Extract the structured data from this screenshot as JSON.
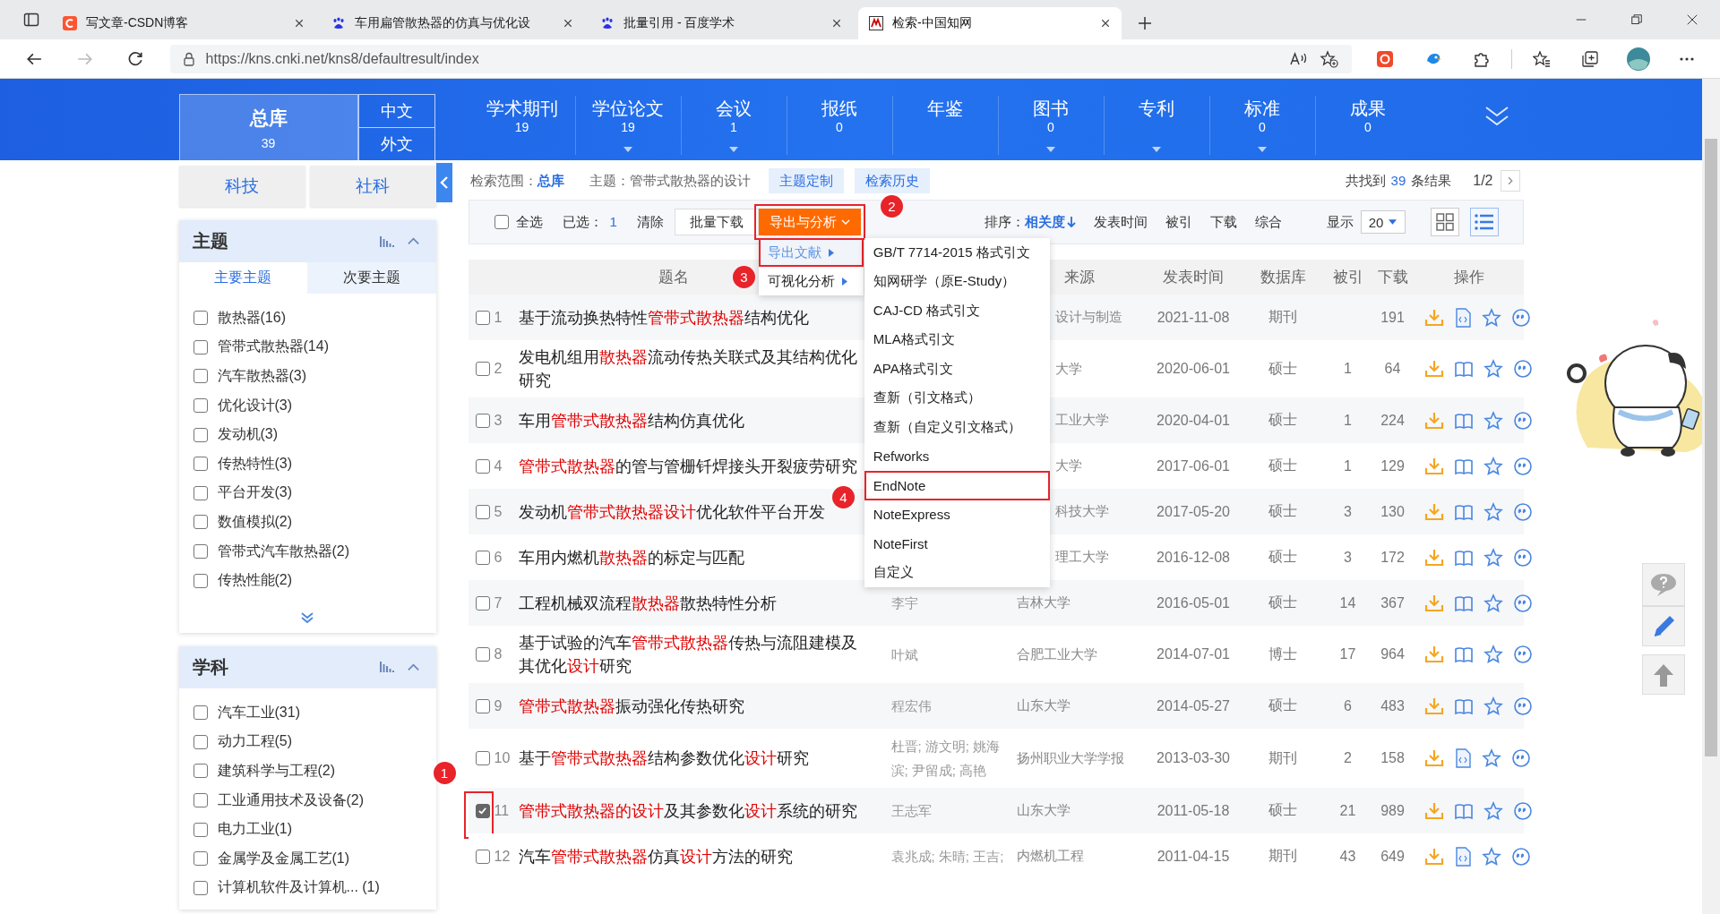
{
  "browser": {
    "tabs": [
      {
        "title": "写文章-CSDN博客",
        "kind": "csdn",
        "selected": false
      },
      {
        "title": "车用扁管散热器的仿真与优化设",
        "kind": "baidu",
        "selected": false
      },
      {
        "title": "批量引用 - 百度学术",
        "kind": "baidu",
        "selected": false
      },
      {
        "title": "检索-中国知网",
        "kind": "cnki",
        "selected": true
      }
    ],
    "url": "https://kns.cnki.net/kns8/defaultresult/index"
  },
  "nav": {
    "main": {
      "label": "总库",
      "count": "39"
    },
    "languages": [
      "中文",
      "外文"
    ],
    "items": [
      {
        "label": "学术期刊",
        "count": "19",
        "dropdown": false
      },
      {
        "label": "学位论文",
        "count": "19",
        "dropdown": true
      },
      {
        "label": "会议",
        "count": "1",
        "dropdown": true
      },
      {
        "label": "报纸",
        "count": "0",
        "dropdown": false
      },
      {
        "label": "年鉴",
        "dropdown": false
      },
      {
        "label": "图书",
        "count": "0",
        "dropdown": true
      },
      {
        "label": "专利",
        "dropdown": true
      },
      {
        "label": "标准",
        "count": "0",
        "dropdown": true
      },
      {
        "label": "成果",
        "count": "0",
        "dropdown": false
      }
    ]
  },
  "sidebar": {
    "tabs": [
      "科技",
      "社科"
    ],
    "panels": [
      {
        "title": "主题",
        "subtabs": [
          {
            "label": "主要主题",
            "selected": true
          },
          {
            "label": "次要主题",
            "selected": false
          }
        ],
        "more": true,
        "items": [
          {
            "label": "散热器(16)",
            "checked": false
          },
          {
            "label": "管带式散热器(14)",
            "checked": false
          },
          {
            "label": "汽车散热器(3)",
            "checked": false
          },
          {
            "label": "优化设计(3)",
            "checked": false
          },
          {
            "label": "发动机(3)",
            "checked": false
          },
          {
            "label": "传热特性(3)",
            "checked": false
          },
          {
            "label": "平台开发(3)",
            "checked": false
          },
          {
            "label": "数值模拟(2)",
            "checked": false
          },
          {
            "label": "管带式汽车散热器(2)",
            "checked": false
          },
          {
            "label": "传热性能(2)",
            "checked": false
          }
        ]
      },
      {
        "title": "学科",
        "more": false,
        "items": [
          {
            "label": "汽车工业(31)",
            "checked": false
          },
          {
            "label": "动力工程(5)",
            "checked": false
          },
          {
            "label": "建筑科学与工程(2)",
            "checked": false
          },
          {
            "label": "工业通用技术及设备(2)",
            "checked": false
          },
          {
            "label": "电力工业(1)",
            "checked": false
          },
          {
            "label": "金属学及金属工艺(1)",
            "checked": false
          },
          {
            "label": "计算机软件及计算机... (1)",
            "checked": false
          }
        ]
      }
    ]
  },
  "search_info": {
    "scope_label": "检索范围：",
    "scope": "总库",
    "topic": "主题：管带式散热器的设计",
    "chips": [
      "主题定制",
      "检索历史"
    ],
    "total_prefix": "共找到",
    "total": "39",
    "total_suffix": "条结果",
    "page": "1/2"
  },
  "toolbar": {
    "select_all": {
      "label": "全选",
      "checked": false
    },
    "selected_label": "已选：",
    "selected_count": "1",
    "clear": "清除",
    "batch_download": "批量下载",
    "export": {
      "label": "导出与分析",
      "framed": true,
      "callout": "2"
    },
    "sort_label": "排序：",
    "sort_options": [
      {
        "label": "相关度",
        "selected": true
      },
      {
        "label": "发表时间",
        "selected": false
      },
      {
        "label": "被引",
        "selected": false
      },
      {
        "label": "下载",
        "selected": false
      },
      {
        "label": "综合",
        "selected": false
      }
    ],
    "display_label": "显示",
    "page_size": "20",
    "views": [
      {
        "kind": "grid",
        "selected": false
      },
      {
        "kind": "list",
        "selected": true
      }
    ]
  },
  "export_menu": {
    "items": [
      {
        "label": "导出文献",
        "selected": true,
        "framed": true,
        "callout": "3"
      },
      {
        "label": "可视化分析",
        "selected": false,
        "framed": false
      }
    ],
    "submenu": [
      {
        "label": "GB/T 7714-2015 格式引文",
        "framed": false
      },
      {
        "label": "知网研学（原E-Study）",
        "framed": false
      },
      {
        "label": "CAJ-CD 格式引文",
        "framed": false
      },
      {
        "label": "MLA格式引文",
        "framed": false
      },
      {
        "label": "APA格式引文",
        "framed": false
      },
      {
        "label": "查新（引文格式）",
        "framed": false
      },
      {
        "label": "查新（自定义引文格式）",
        "framed": false
      },
      {
        "label": "Refworks",
        "framed": false
      },
      {
        "label": "EndNote",
        "framed": true,
        "callout": "4"
      },
      {
        "label": "NoteExpress",
        "framed": false
      },
      {
        "label": "NoteFirst",
        "framed": false
      },
      {
        "label": "自定义",
        "framed": false
      }
    ]
  },
  "table": {
    "columns": [
      "题名",
      "来源",
      "发表时间",
      "数据库",
      "被引",
      "下载",
      "操作"
    ],
    "rows": [
      {
        "number": "1",
        "checked": false,
        "framed": false,
        "title": [
          {
            "text": "基于流动换热特性",
            "highlight": false
          },
          {
            "text": "管带式散热器",
            "highlight": true
          },
          {
            "text": "结构优化",
            "highlight": false
          }
        ],
        "source": "设计与制造",
        "source_clipped": true,
        "date": "2021-11-08",
        "database": "期刊",
        "downloads": "191",
        "kind": "html"
      },
      {
        "number": "2",
        "checked": false,
        "framed": false,
        "title": [
          {
            "text": "发电机组用",
            "highlight": false
          },
          {
            "text": "散热器",
            "highlight": true
          },
          {
            "text": "流动传热关联式及其结构优化研究",
            "highlight": false
          }
        ],
        "source": "大学",
        "source_clipped": true,
        "date": "2020-06-01",
        "database": "硕士",
        "cited": "1",
        "downloads": "64",
        "kind": "book"
      },
      {
        "number": "3",
        "checked": false,
        "framed": false,
        "title": [
          {
            "text": "车用",
            "highlight": false
          },
          {
            "text": "管带式散热器",
            "highlight": true
          },
          {
            "text": "结构仿真优化",
            "highlight": false
          }
        ],
        "source": "工业大学",
        "source_clipped": true,
        "date": "2020-04-01",
        "database": "硕士",
        "cited": "1",
        "downloads": "224",
        "kind": "book"
      },
      {
        "number": "4",
        "checked": false,
        "framed": false,
        "title": [
          {
            "text": "管带式散热器",
            "highlight": true
          },
          {
            "text": "的管与管栅钎焊接头开裂疲劳研究",
            "highlight": false
          }
        ],
        "source": "大学",
        "source_clipped": true,
        "date": "2017-06-01",
        "database": "硕士",
        "cited": "1",
        "downloads": "129",
        "kind": "book"
      },
      {
        "number": "5",
        "checked": false,
        "framed": false,
        "title": [
          {
            "text": "发动机",
            "highlight": false
          },
          {
            "text": "管带式散热器设计",
            "highlight": true
          },
          {
            "text": "优化软件平台开发",
            "highlight": false
          }
        ],
        "source": "科技大学",
        "source_clipped": true,
        "date": "2017-05-20",
        "database": "硕士",
        "cited": "3",
        "downloads": "130",
        "kind": "book"
      },
      {
        "number": "6",
        "checked": false,
        "framed": false,
        "title": [
          {
            "text": "车用内燃机",
            "highlight": false
          },
          {
            "text": "散热器",
            "highlight": true
          },
          {
            "text": "的标定与匹配",
            "highlight": false
          }
        ],
        "source": "理工大学",
        "source_clipped": true,
        "date": "2016-12-08",
        "database": "硕士",
        "cited": "3",
        "downloads": "172",
        "kind": "book"
      },
      {
        "number": "7",
        "checked": false,
        "framed": false,
        "title": [
          {
            "text": "工程机械双流程",
            "highlight": false
          },
          {
            "text": "散热器",
            "highlight": true
          },
          {
            "text": "散热特性分析",
            "highlight": false
          }
        ],
        "author": "李宇",
        "source": "吉林大学",
        "source_clipped": false,
        "date": "2016-05-01",
        "database": "硕士",
        "cited": "14",
        "downloads": "367",
        "kind": "book"
      },
      {
        "number": "8",
        "checked": false,
        "framed": false,
        "title": [
          {
            "text": "基于试验的汽车",
            "highlight": false
          },
          {
            "text": "管带式散热器",
            "highlight": true
          },
          {
            "text": "传热与流阻建模及其优化",
            "highlight": false
          },
          {
            "text": "设计",
            "highlight": true
          },
          {
            "text": "研究",
            "highlight": false
          }
        ],
        "author": "叶斌",
        "source": "合肥工业大学",
        "source_clipped": false,
        "date": "2014-07-01",
        "database": "博士",
        "cited": "17",
        "downloads": "964",
        "kind": "book"
      },
      {
        "number": "9",
        "checked": false,
        "framed": false,
        "title": [
          {
            "text": "管带式散热器",
            "highlight": true
          },
          {
            "text": "振动强化传热研究",
            "highlight": false
          }
        ],
        "author": "程宏伟",
        "source": "山东大学",
        "source_clipped": false,
        "date": "2014-05-27",
        "database": "硕士",
        "cited": "6",
        "downloads": "483",
        "kind": "book"
      },
      {
        "number": "10",
        "checked": false,
        "framed": false,
        "title": [
          {
            "text": "基于",
            "highlight": false
          },
          {
            "text": "管带式散热器",
            "highlight": true
          },
          {
            "text": "结构参数优化",
            "highlight": false
          },
          {
            "text": "设计",
            "highlight": true
          },
          {
            "text": "研究",
            "highlight": false
          }
        ],
        "author": "杜晋; 游文明; 姚海滨; 尹留成; 高艳",
        "source": "扬州职业大学学报",
        "source_clipped": false,
        "date": "2013-03-30",
        "database": "期刊",
        "cited": "2",
        "downloads": "158",
        "kind": "html"
      },
      {
        "number": "11",
        "checked": true,
        "framed": true,
        "callout": "1",
        "title": [
          {
            "text": "管带式散热器的设计",
            "highlight": true
          },
          {
            "text": "及其参数化",
            "highlight": false
          },
          {
            "text": "设计",
            "highlight": true
          },
          {
            "text": "系统的研究",
            "highlight": false
          }
        ],
        "author": "王志军",
        "source": "山东大学",
        "source_clipped": false,
        "date": "2011-05-18",
        "database": "硕士",
        "cited": "21",
        "downloads": "989",
        "kind": "book"
      },
      {
        "number": "12",
        "checked": false,
        "framed": false,
        "title": [
          {
            "text": "汽车",
            "highlight": false
          },
          {
            "text": "管带式散热器",
            "highlight": true
          },
          {
            "text": "仿真",
            "highlight": false
          },
          {
            "text": "设计",
            "highlight": true
          },
          {
            "text": "方法的研究",
            "highlight": false
          }
        ],
        "author": "袁兆成; 朱晴; 王吉;",
        "source": "内燃机工程",
        "source_clipped": false,
        "date": "2011-04-15",
        "database": "期刊",
        "cited": "43",
        "downloads": "649",
        "kind": "html"
      }
    ]
  }
}
